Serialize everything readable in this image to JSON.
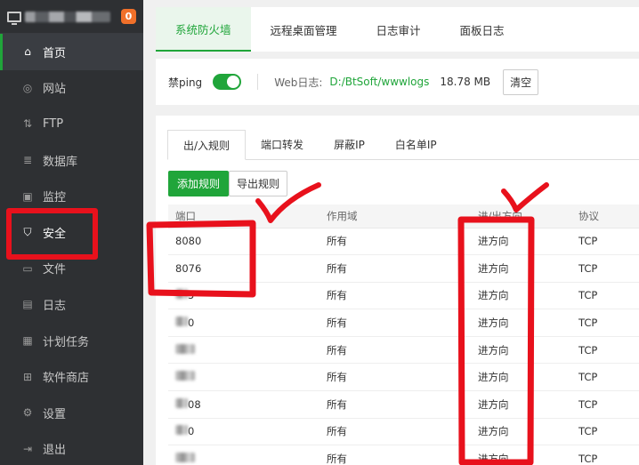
{
  "sidebar": {
    "badge": "0",
    "items": [
      {
        "label": "首页",
        "icon": "home-icon"
      },
      {
        "label": "网站",
        "icon": "globe-icon"
      },
      {
        "label": "FTP",
        "icon": "ftp-icon"
      },
      {
        "label": "数据库",
        "icon": "database-icon"
      },
      {
        "label": "监控",
        "icon": "monitor-icon"
      },
      {
        "label": "安全",
        "icon": "shield-icon"
      },
      {
        "label": "文件",
        "icon": "folder-icon"
      },
      {
        "label": "日志",
        "icon": "log-icon"
      },
      {
        "label": "计划任务",
        "icon": "calendar-icon"
      },
      {
        "label": "软件商店",
        "icon": "grid-icon"
      },
      {
        "label": "设置",
        "icon": "gear-icon"
      },
      {
        "label": "退出",
        "icon": "logout-icon"
      }
    ]
  },
  "tabs": [
    "系统防火墙",
    "远程桌面管理",
    "日志审计",
    "面板日志"
  ],
  "toolbar": {
    "ping_label": "禁ping",
    "weblog_label": "Web日志:",
    "weblog_path": "D:/BtSoft/wwwlogs",
    "weblog_size": "18.78 MB",
    "clear_label": "清空"
  },
  "subtabs": [
    "出/入规则",
    "端口转发",
    "屏蔽IP",
    "白名单IP"
  ],
  "buttons": {
    "add": "添加规则",
    "export": "导出规则"
  },
  "table": {
    "headers": [
      "端口",
      "作用域",
      "进/出方向",
      "协议"
    ],
    "rows": [
      [
        "8080",
        "所有",
        "进方向",
        "TCP"
      ],
      [
        "8076",
        "所有",
        "进方向",
        "TCP"
      ],
      [
        "5",
        "所有",
        "进方向",
        "TCP"
      ],
      [
        "0",
        "所有",
        "进方向",
        "TCP"
      ],
      [
        "",
        "所有",
        "进方向",
        "TCP"
      ],
      [
        "",
        "所有",
        "进方向",
        "TCP"
      ],
      [
        "08",
        "所有",
        "进方向",
        "TCP"
      ],
      [
        "0",
        "所有",
        "进方向",
        "TCP"
      ],
      [
        "",
        "所有",
        "进方向",
        "TCP"
      ]
    ]
  },
  "colors": {
    "accent": "#20a53a",
    "annotation": "#e8111c"
  }
}
